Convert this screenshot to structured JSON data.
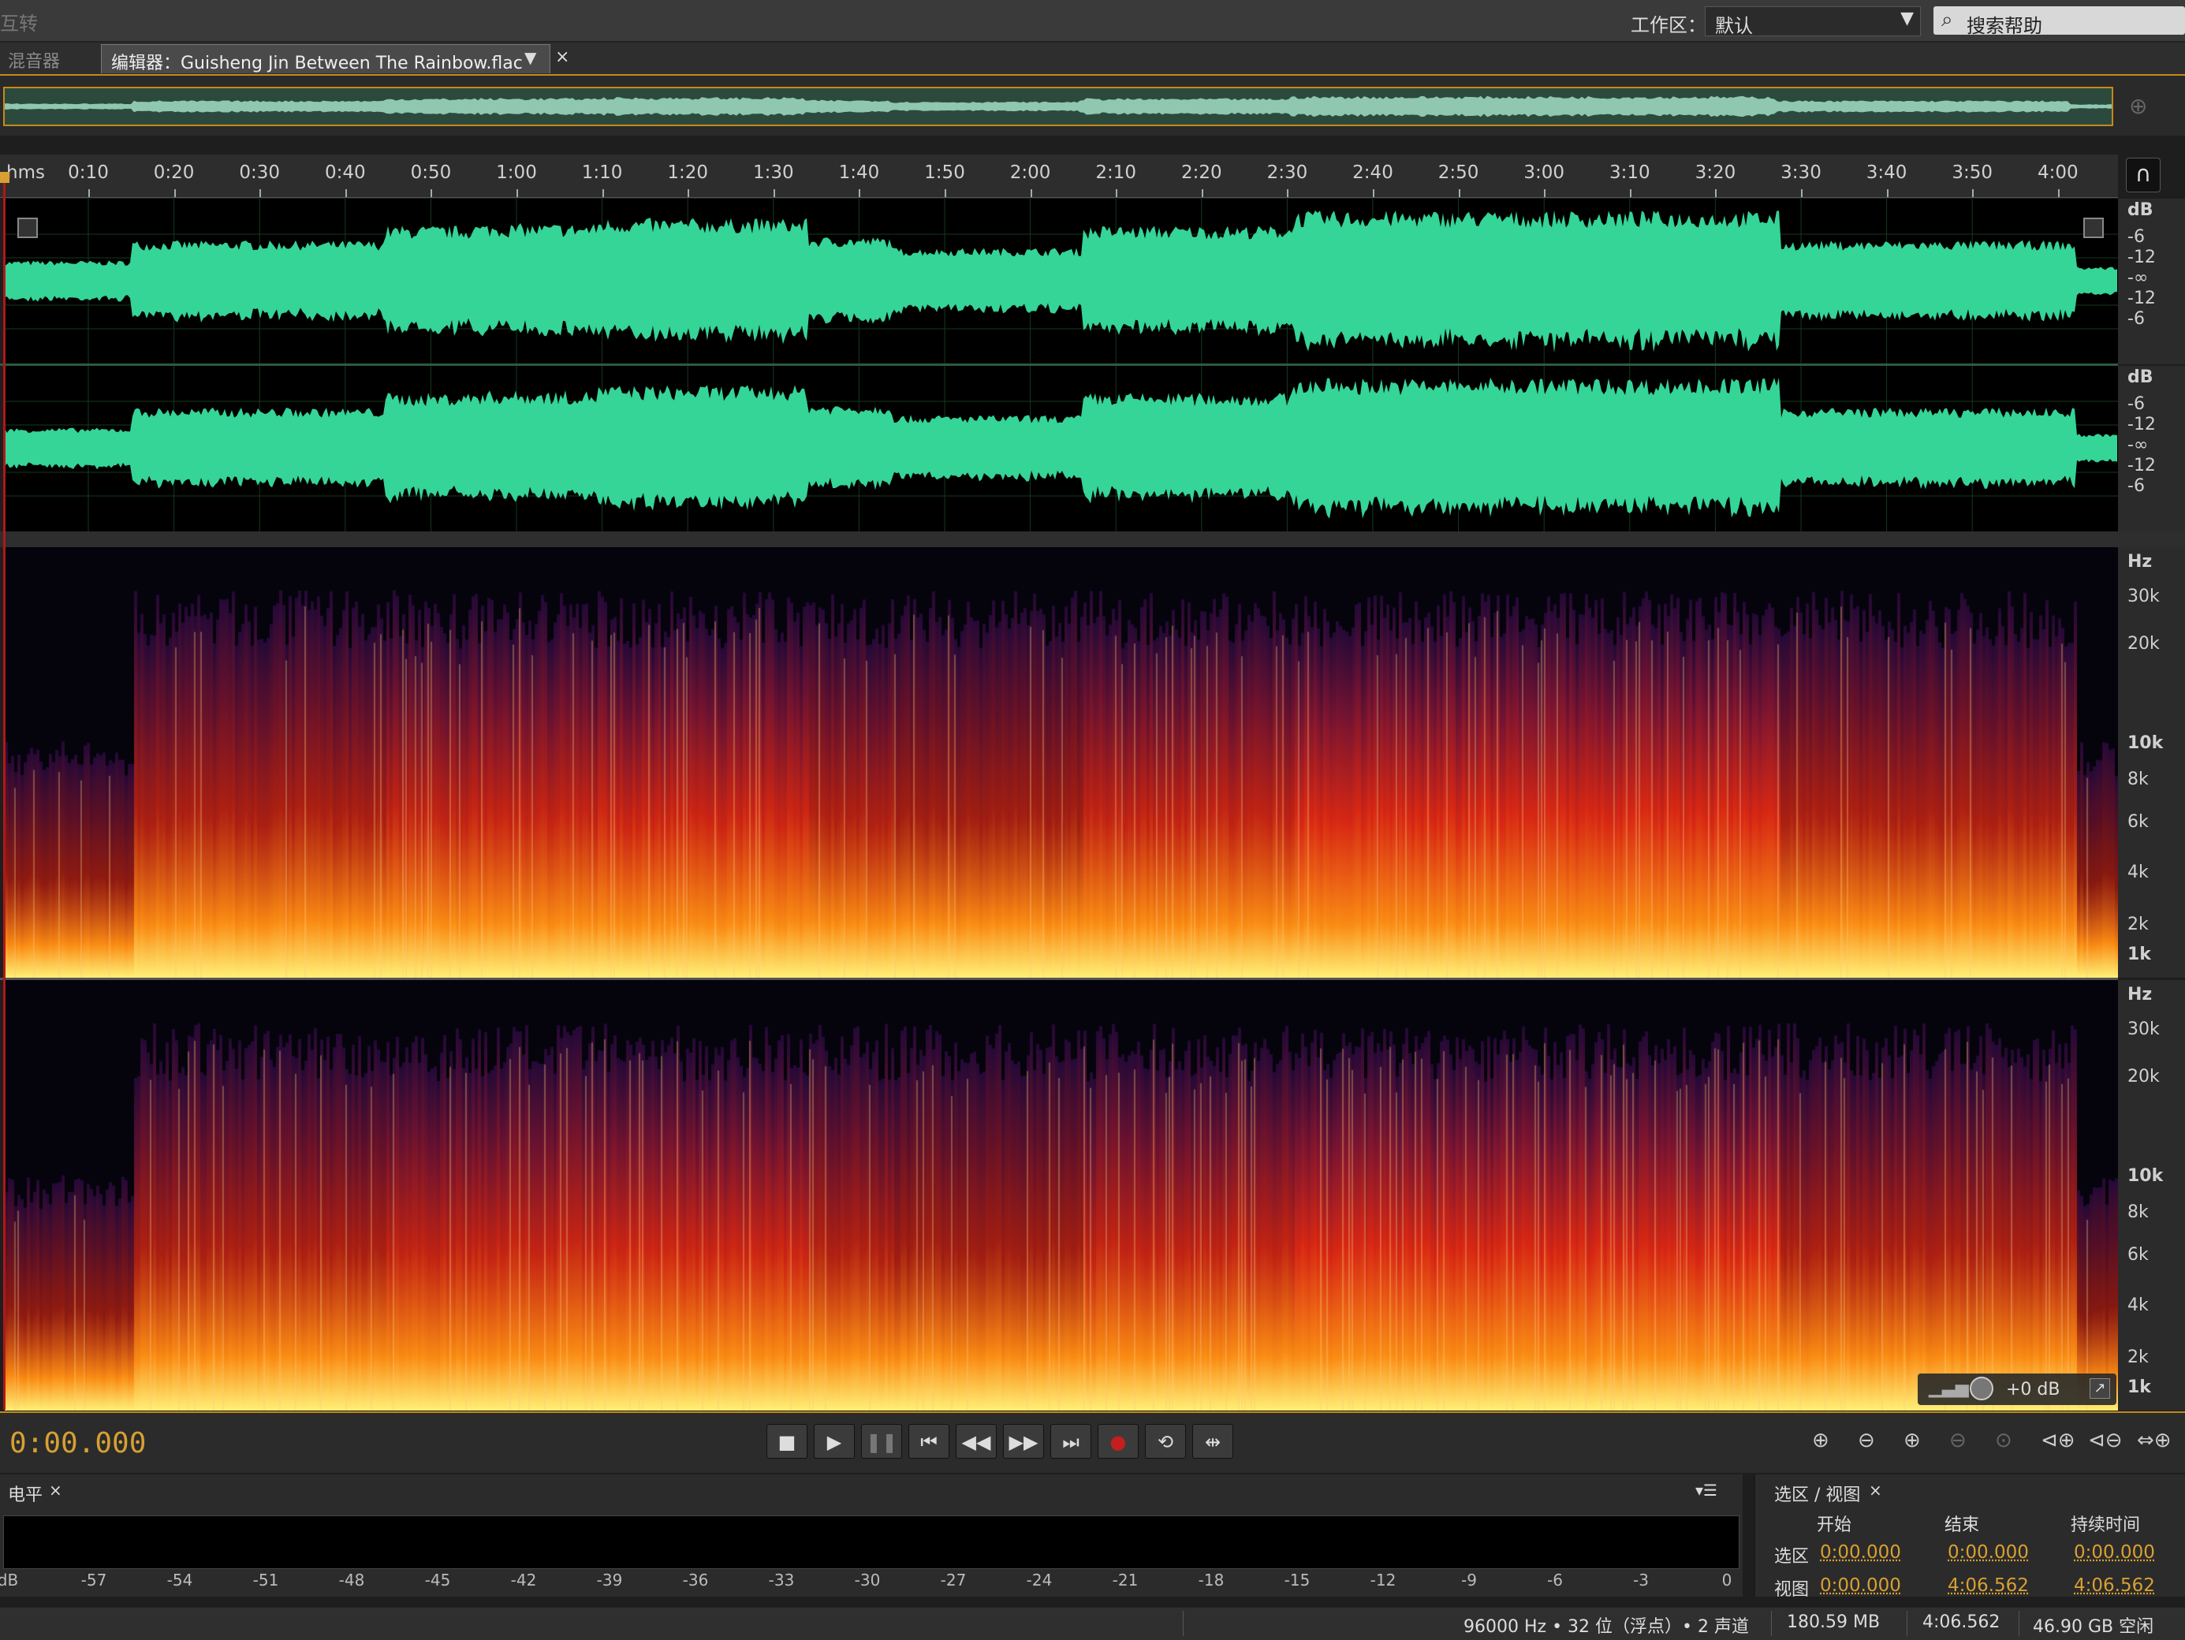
{
  "topbar": {
    "left_text": "互转",
    "workspace_label": "工作区：",
    "workspace_value": "默认",
    "search_placeholder": "搜索帮助"
  },
  "tabs": {
    "mixer": "混音器",
    "editor": "编辑器：Guisheng Jin Between The Rainbow.flac",
    "close": "×"
  },
  "ruler": {
    "unit": "hms",
    "ticks": [
      "0:10",
      "0:20",
      "0:30",
      "0:40",
      "0:50",
      "1:00",
      "1:10",
      "1:20",
      "1:30",
      "1:40",
      "1:50",
      "2:00",
      "2:10",
      "2:20",
      "2:30",
      "2:40",
      "2:50",
      "3:00",
      "3:10",
      "3:20",
      "3:30",
      "3:40",
      "3:50",
      "4:00"
    ]
  },
  "waveform": {
    "color": "#35d497",
    "db_scale": [
      "dB",
      "-6",
      "-12",
      "-∞",
      "-12",
      "-6"
    ]
  },
  "spectrogram": {
    "hz_scale": [
      "Hz",
      "30k",
      "20k",
      "10k",
      "8k",
      "6k",
      "4k",
      "2k",
      "1k"
    ]
  },
  "gain": {
    "value": "+0 dB"
  },
  "transport": {
    "time": "0:00.000",
    "buttons": [
      "stop",
      "play",
      "pause",
      "to-start",
      "rewind",
      "fast-forward",
      "to-end",
      "record",
      "loop",
      "skip-selection"
    ]
  },
  "level_panel": {
    "tab": "电平",
    "close": "×",
    "scale": [
      "dB",
      "-57",
      "-54",
      "-51",
      "-48",
      "-45",
      "-42",
      "-39",
      "-36",
      "-33",
      "-30",
      "-27",
      "-24",
      "-21",
      "-18",
      "-15",
      "-12",
      "-9",
      "-6",
      "-3",
      "0"
    ]
  },
  "selection_panel": {
    "tab": "选区 / 视图",
    "close": "×",
    "headers": [
      "开始",
      "结束",
      "持续时间"
    ],
    "rows": [
      {
        "label": "选区",
        "start": "0:00.000",
        "end": "0:00.000",
        "duration": "0:00.000"
      },
      {
        "label": "视图",
        "start": "0:00.000",
        "end": "4:06.562",
        "duration": "4:06.562"
      }
    ]
  },
  "status": {
    "format": "96000 Hz • 32 位（浮点）• 2 声道",
    "size": "180.59 MB",
    "duration": "4:06.562",
    "free": "46.90 GB 空闲"
  }
}
